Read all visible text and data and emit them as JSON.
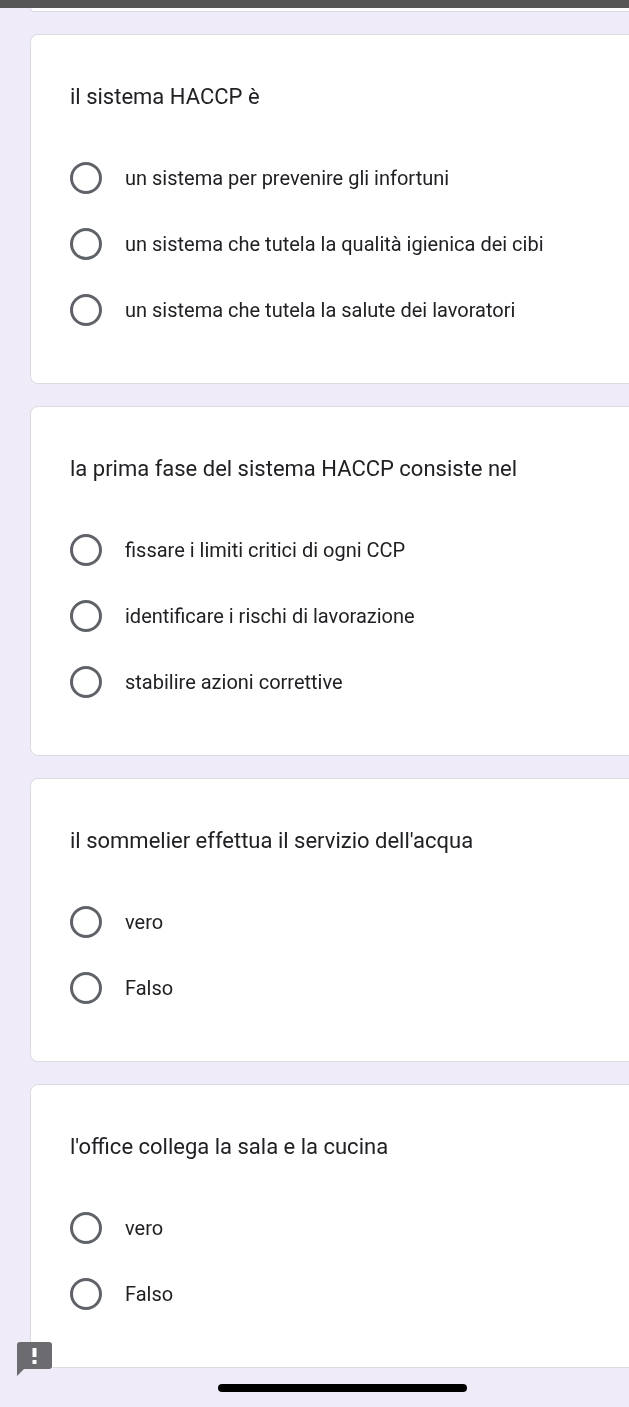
{
  "questions": [
    {
      "title": "il sistema HACCP è",
      "options": [
        {
          "label": "un sistema per prevenire gli infortuni",
          "selected": false
        },
        {
          "label": "un sistema che tutela la qualità igienica dei cibi",
          "selected": false
        },
        {
          "label": "un sistema che tutela la salute dei lavoratori",
          "selected": false
        }
      ]
    },
    {
      "title": "la prima fase del sistema HACCP consiste nel",
      "options": [
        {
          "label": "fissare i limiti critici di ogni CCP",
          "selected": false
        },
        {
          "label": "identificare i rischi di lavorazione",
          "selected": false
        },
        {
          "label": "stabilire azioni correttive",
          "selected": false
        }
      ]
    },
    {
      "title": "il sommelier effettua il servizio dell'acqua",
      "options": [
        {
          "label": "vero",
          "selected": false
        },
        {
          "label": "Falso",
          "selected": false
        }
      ]
    },
    {
      "title": "l'office collega la sala e la cucina",
      "options": [
        {
          "label": "vero",
          "selected": false
        },
        {
          "label": "Falso",
          "selected": false
        }
      ]
    }
  ]
}
